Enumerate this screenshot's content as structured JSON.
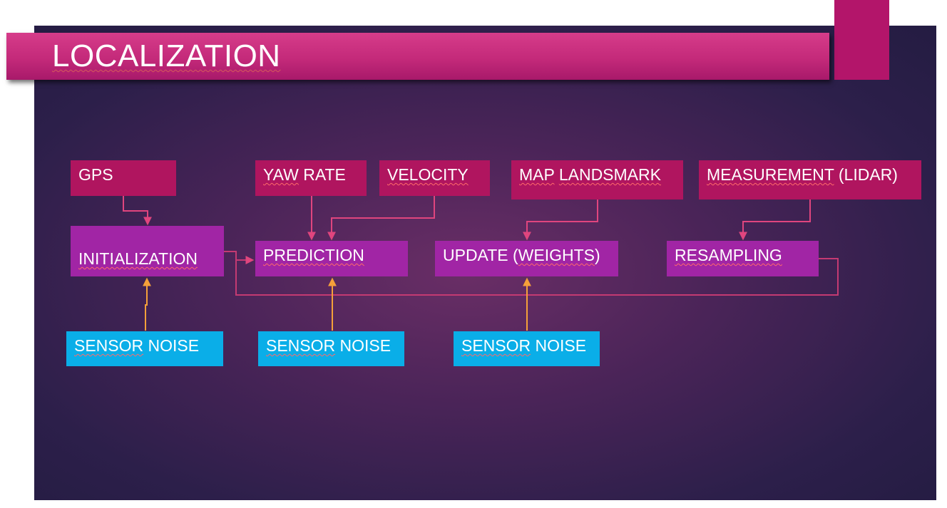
{
  "slide": {
    "title": "LOCALIZATION"
  },
  "inputs": {
    "gps": "GPS",
    "yaw_rate": [
      "YAW",
      "RATE"
    ],
    "velocity": "VELOCITY",
    "map_landmark": [
      "MAP",
      "LANDSMARK"
    ],
    "measurement": [
      "MEASUREMENT",
      "(LIDAR)"
    ]
  },
  "steps": {
    "initialization": "INITIALIZATION",
    "prediction": "PREDICTION",
    "update": [
      "UPDATE (",
      "WEIGHTS",
      ")"
    ],
    "resampling": "RESAMPLING"
  },
  "noise": [
    {
      "a": "SENSOR",
      "b": "NOISE"
    },
    {
      "a": "SENSOR",
      "b": "NOISE"
    },
    {
      "a": "SENSOR",
      "b": "NOISE"
    }
  ],
  "colors": {
    "input_box": "#b0155f",
    "step_box": "#a125a5",
    "noise_box": "#0aaee8",
    "title_bar": "#c42a7a",
    "input_arrow": "#e0457e",
    "noise_arrow": "#f5a03a"
  }
}
